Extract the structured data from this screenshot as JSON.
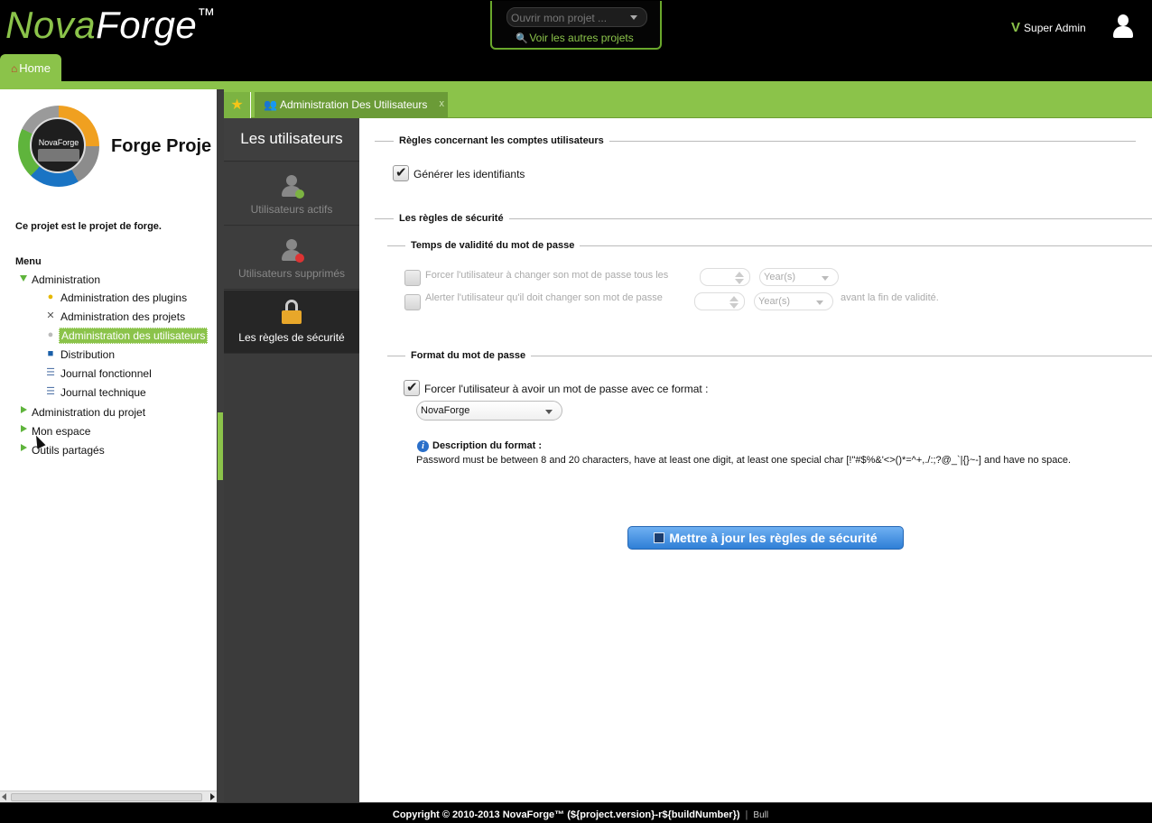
{
  "header": {
    "logo_prefix": "Nova",
    "logo_suffix": "Forge",
    "logo_tm": "™",
    "project_select_placeholder": "Ouvrir mon projet ...",
    "other_projects_link": "Voir les autres projets",
    "user_name": "Super Admin",
    "home_tab": "Home"
  },
  "sidebar": {
    "badge_text": "NovaForge",
    "project_title": "Forge Proje",
    "project_description": "Ce projet est le projet de forge.",
    "menu_title": "Menu",
    "tree": {
      "administration": "Administration",
      "plugins": "Administration des plugins",
      "projects": "Administration des projets",
      "users": "Administration des utilisateurs",
      "distribution": "Distribution",
      "journal_fonctionnel": "Journal fonctionnel",
      "journal_technique": "Journal technique",
      "admin_projet": "Administration du projet",
      "mon_espace": "Mon espace",
      "outils_partages": "Outils partagés"
    }
  },
  "tabs": {
    "favorites_icon": "star-icon",
    "admin_users_tab": "Administration Des Utilisateurs",
    "close_label": "x"
  },
  "vnav": {
    "title": "Les utilisateurs",
    "items": [
      {
        "label": "Utilisateurs actifs",
        "icon": "user-add-icon"
      },
      {
        "label": "Utilisateurs supprimés",
        "icon": "user-remove-icon"
      },
      {
        "label": "Les règles de sécurité",
        "icon": "lock-icon"
      }
    ]
  },
  "main": {
    "accounts_legend": "Règles concernant les comptes utilisateurs",
    "generate_ids_label": "Générer les identifiants",
    "generate_ids_checked": true,
    "security_legend": "Les règles de sécurité",
    "validity_legend": "Temps de validité du mot de passe",
    "force_change_label": "Forcer l'utilisateur à changer son mot de passe tous les",
    "force_change_unit": "Year(s)",
    "alert_label": "Alerter l'utilisateur qu'il doit changer son mot de passe",
    "alert_unit": "Year(s)",
    "alert_suffix": "avant la fin de validité.",
    "format_legend": "Format du mot de passe",
    "force_format_label": "Forcer l'utilisateur à avoir un mot de passe avec ce format :",
    "force_format_checked": true,
    "format_value": "NovaForge",
    "format_desc_title": "Description du format :",
    "format_desc_text": "Password must be between 8 and 20 characters, have at least one digit, at least one special char [!\"#$%&'<>()*=^+,./:;?@_`|{}~-] and have no space.",
    "update_button": "Mettre à jour les règles de sécurité"
  },
  "footer": {
    "copyright": "Copyright © 2010-2013 NovaForge™ (${project.version}-r${buildNumber})",
    "separator": "|",
    "brand": "Bull"
  }
}
